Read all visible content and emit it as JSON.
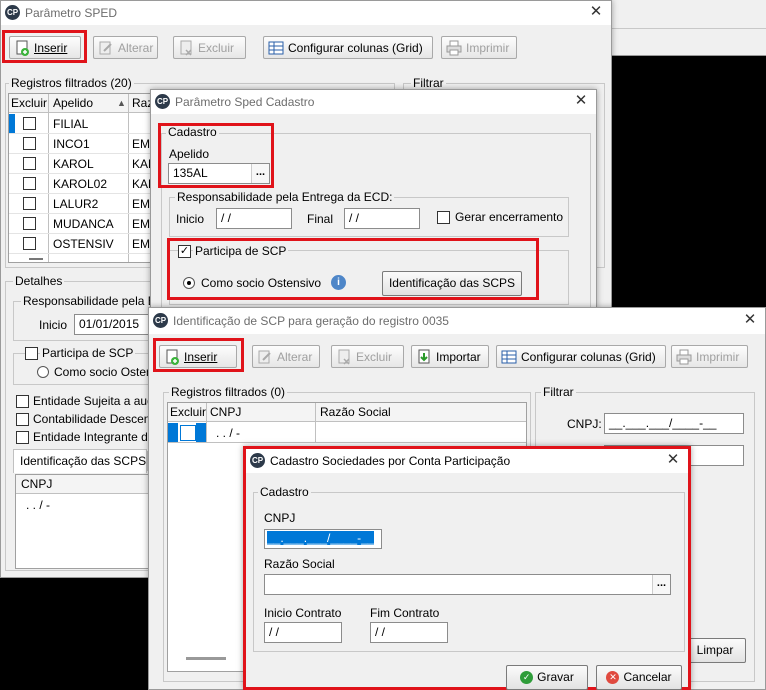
{
  "win1": {
    "title": "Parâmetro SPED",
    "toolbar": {
      "inserir": "Inserir",
      "alterar": "Alterar",
      "excluir": "Excluir",
      "configurar": "Configurar colunas (Grid)",
      "imprimir": "Imprimir"
    },
    "registros_label": "Registros filtrados (20)",
    "filtrar_label": "Filtrar",
    "grid_headers": [
      "Excluir",
      "Apelido",
      "Razã"
    ],
    "rows": [
      {
        "apelido": "FILIAL",
        "razao": ""
      },
      {
        "apelido": "INCO1",
        "razao": "EMI"
      },
      {
        "apelido": "KAROL",
        "razao": "KAR"
      },
      {
        "apelido": "KAROL02",
        "razao": "KAR"
      },
      {
        "apelido": "LALUR2",
        "razao": "EMI"
      },
      {
        "apelido": "MUDANCA",
        "razao": "EMI"
      },
      {
        "apelido": "OSTENSIV",
        "razao": "EMI"
      }
    ],
    "detalhes_label": "Detalhes",
    "resp_label": "Responsabilidade pela En",
    "inicio_label": "Inicio",
    "inicio_value": "01/01/2015",
    "participa_label": "Participa de SCP",
    "como_socio": "Como socio Osten",
    "entidade1": "Entidade Sujeita a audi",
    "entidade2": "Contabilidade Descent",
    "entidade3": "Entidade Integrante de",
    "tab_label": "Identificação das SCPS",
    "cnpj_header": "CNPJ",
    "cnpj_row": ". . /  -"
  },
  "win2": {
    "title": "Parâmetro Sped Cadastro",
    "cadastro_label": "Cadastro",
    "apelido_label": "Apelido",
    "apelido_value": "135AL",
    "ellipsis": "...",
    "resp_label": "Responsabilidade pela Entrega da ECD:",
    "inicio_label": "Inicio",
    "inicio_value": " / /",
    "final_label": "Final",
    "final_value": " / /",
    "gerar_label": "Gerar encerramento",
    "participa_label": "Participa de SCP",
    "participa_check": "✓",
    "como_socio_label": "Como socio Ostensivo",
    "info_icon": "i",
    "identificacao_button": "Identificação das SCPS"
  },
  "win3": {
    "title": "Identificação de SCP para geração do registro 0035",
    "toolbar": {
      "inserir": "Inserir",
      "alterar": "Alterar",
      "excluir": "Excluir",
      "importar": "Importar",
      "configurar": "Configurar colunas (Grid)",
      "imprimir": "Imprimir"
    },
    "registros_label": "Registros filtrados (0)",
    "grid_headers": [
      "Excluir",
      "CNPJ",
      "Razão Social"
    ],
    "row_cnpj": ". . /  -",
    "filtrar_label": "Filtrar",
    "cnpj_label": "CNPJ:",
    "cnpj_filter_value": "__.___.___/____-__",
    "limpar_button": "Limpar"
  },
  "win4": {
    "title": "Cadastro Sociedades por Conta Participação",
    "cadastro_label": "Cadastro",
    "cnpj_label": "CNPJ",
    "cnpj_value": "__.___.___/____-__",
    "razao_label": "Razão Social",
    "razao_value": "",
    "ellipsis": "...",
    "inicio_label": "Inicio Contrato",
    "inicio_value": " / /",
    "fim_label": "Fim Contrato",
    "fim_value": " / /",
    "gravar_button": "Gravar",
    "cancelar_button": "Cancelar"
  },
  "colors": {
    "highlight_red": "#e0131a",
    "selection_blue": "#0078d7"
  }
}
